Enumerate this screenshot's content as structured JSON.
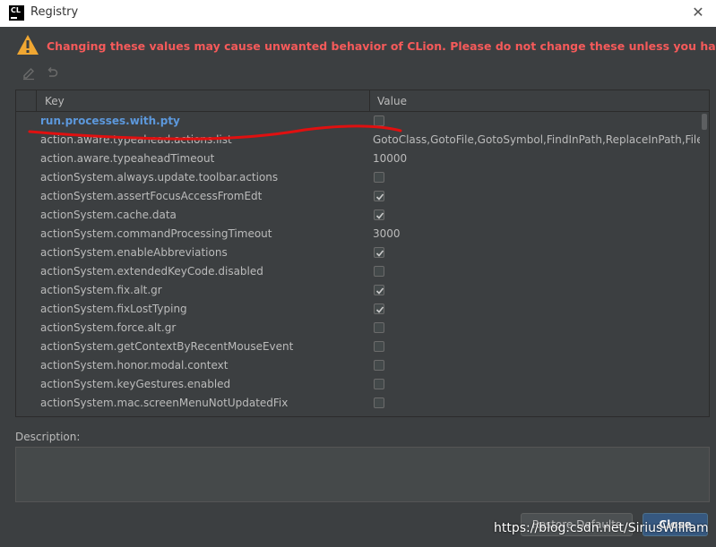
{
  "window": {
    "title": "Registry",
    "logo_text": "CL",
    "close_glyph": "✕"
  },
  "warning": {
    "icon": "warning-icon",
    "text": "Changing these values may cause unwanted behavior of CLion. Please do not change these unless you have been asked.",
    "color": "#f55a5a"
  },
  "toolbar": {
    "edit_icon": "edit-icon",
    "revert_icon": "revert-icon"
  },
  "table": {
    "columns": [
      "Key",
      "Value"
    ],
    "rows": [
      {
        "key": "run.processes.with.pty",
        "type": "checkbox",
        "checked": false,
        "value": "",
        "modified": true
      },
      {
        "key": "action.aware.typeahead.actions.list",
        "type": "text",
        "checked": false,
        "value": "GotoClass,GotoFile,GotoSymbol,FindInPath,ReplaceInPath,FileSt",
        "modified": false
      },
      {
        "key": "action.aware.typeaheadTimeout",
        "type": "text",
        "checked": false,
        "value": "10000",
        "modified": false
      },
      {
        "key": "actionSystem.always.update.toolbar.actions",
        "type": "checkbox",
        "checked": false,
        "value": "",
        "modified": false
      },
      {
        "key": "actionSystem.assertFocusAccessFromEdt",
        "type": "checkbox",
        "checked": true,
        "value": "",
        "modified": false
      },
      {
        "key": "actionSystem.cache.data",
        "type": "checkbox",
        "checked": true,
        "value": "",
        "modified": false
      },
      {
        "key": "actionSystem.commandProcessingTimeout",
        "type": "text",
        "checked": false,
        "value": "3000",
        "modified": false
      },
      {
        "key": "actionSystem.enableAbbreviations",
        "type": "checkbox",
        "checked": true,
        "value": "",
        "modified": false
      },
      {
        "key": "actionSystem.extendedKeyCode.disabled",
        "type": "checkbox",
        "checked": false,
        "value": "",
        "modified": false
      },
      {
        "key": "actionSystem.fix.alt.gr",
        "type": "checkbox",
        "checked": true,
        "value": "",
        "modified": false
      },
      {
        "key": "actionSystem.fixLostTyping",
        "type": "checkbox",
        "checked": true,
        "value": "",
        "modified": false
      },
      {
        "key": "actionSystem.force.alt.gr",
        "type": "checkbox",
        "checked": false,
        "value": "",
        "modified": false
      },
      {
        "key": "actionSystem.getContextByRecentMouseEvent",
        "type": "checkbox",
        "checked": false,
        "value": "",
        "modified": false
      },
      {
        "key": "actionSystem.honor.modal.context",
        "type": "checkbox",
        "checked": false,
        "value": "",
        "modified": false
      },
      {
        "key": "actionSystem.keyGestures.enabled",
        "type": "checkbox",
        "checked": false,
        "value": "",
        "modified": false
      },
      {
        "key": "actionSystem.mac.screenMenuNotUpdatedFix",
        "type": "checkbox",
        "checked": false,
        "value": "",
        "modified": false
      }
    ]
  },
  "description": {
    "label": "Description:",
    "value": ""
  },
  "buttons": {
    "restore_label": "Restore Defaults",
    "close_label": "Close"
  },
  "watermark": "https://blog.csdn.net/SiriusWilliam",
  "colors": {
    "background": "#3c3f41",
    "modified_key": "#5c98dc",
    "annotation_red": "#e01010",
    "primary_button": "#365880"
  }
}
